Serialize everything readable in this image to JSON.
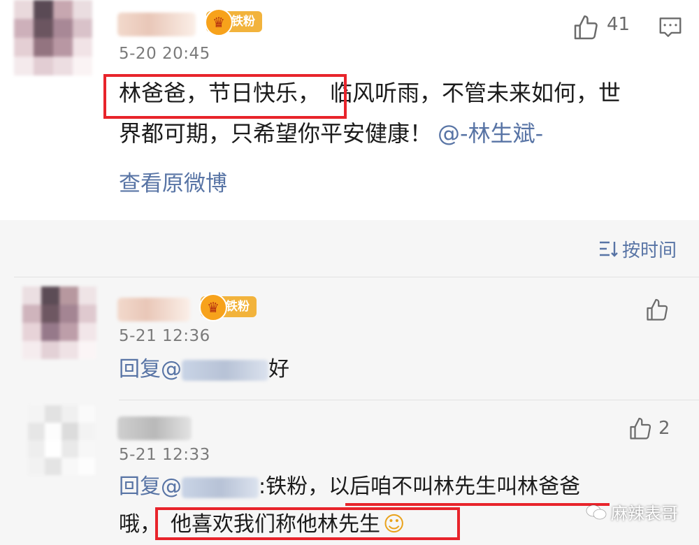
{
  "main_post": {
    "badge": "铁粉",
    "time": "5-20 20:45",
    "like_count": "41",
    "text_highlight": "林爸爸，节日快乐，",
    "text_rest_line1": "临风听雨，不管未来如何，世",
    "text_line2": "界都可期，只希望你平安健康！",
    "mention": "@-林生斌-",
    "view_original": "查看原微博"
  },
  "sort": {
    "label": "按时间"
  },
  "comments": [
    {
      "badge": "铁粉",
      "time": "5-21 12:36",
      "reply_prefix": "回复@",
      "reply_suffix": "好"
    },
    {
      "time": "5-21 12:33",
      "like_count": "2",
      "reply_prefix": "回复@",
      "reply_text": ":铁粉，以后咱不叫林先生叫林爸爸",
      "line2_prefix": "哦，",
      "line2_highlight": "他喜欢我们称他林先生",
      "emoji": "☺"
    }
  ],
  "watermark": "麻辣表哥",
  "colors": {
    "link": "#5874a5",
    "highlight_box": "#e8242b",
    "badge": "#f2b33c"
  }
}
